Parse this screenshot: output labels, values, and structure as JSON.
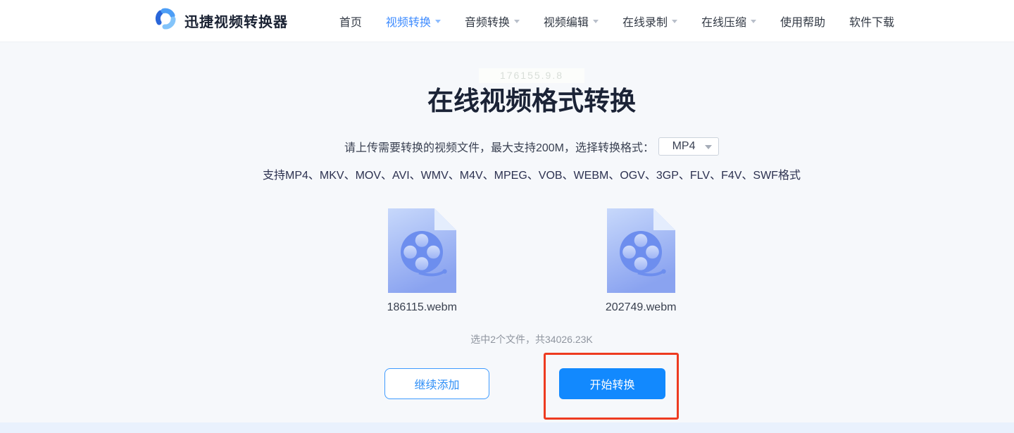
{
  "header": {
    "brand": "迅捷视频转换器",
    "nav": [
      {
        "label": "首页",
        "active": false,
        "caret": false
      },
      {
        "label": "视频转换",
        "active": true,
        "caret": true
      },
      {
        "label": "音频转换",
        "active": false,
        "caret": true
      },
      {
        "label": "视频编辑",
        "active": false,
        "caret": true
      },
      {
        "label": "在线录制",
        "active": false,
        "caret": true
      },
      {
        "label": "在线压缩",
        "active": false,
        "caret": true
      },
      {
        "label": "使用帮助",
        "active": false,
        "caret": false
      },
      {
        "label": "软件下载",
        "active": false,
        "caret": false
      }
    ]
  },
  "main": {
    "watermark": "176155.9.8",
    "title": "在线视频格式转换",
    "upload_hint": "请上传需要转换的视频文件，最大支持200M，选择转换格式：",
    "format_select": {
      "value": "MP4"
    },
    "supported_formats": "支持MP4、MKV、MOV、AVI、WMV、M4V、MPEG、VOB、WEBM、OGV、3GP、FLV、F4V、SWF格式",
    "files": [
      {
        "name": "186115.webm"
      },
      {
        "name": "202749.webm"
      }
    ],
    "selection_summary": "选中2个文件，共34026.23K",
    "buttons": {
      "add_more": "继续添加",
      "start_convert": "开始转换"
    }
  },
  "icons": {
    "logo": "swirl-logo-icon (three blue arcs)",
    "caret": "caret-down-icon (small triangle)",
    "file": "video-file-icon (blue document with film reel)"
  },
  "colors": {
    "primary_blue": "#1289fe",
    "nav_active_blue": "#3f8cff",
    "annotation_red": "#ee3b20",
    "main_background": "#f6f8fb",
    "footer_band": "#e9f1fd"
  }
}
